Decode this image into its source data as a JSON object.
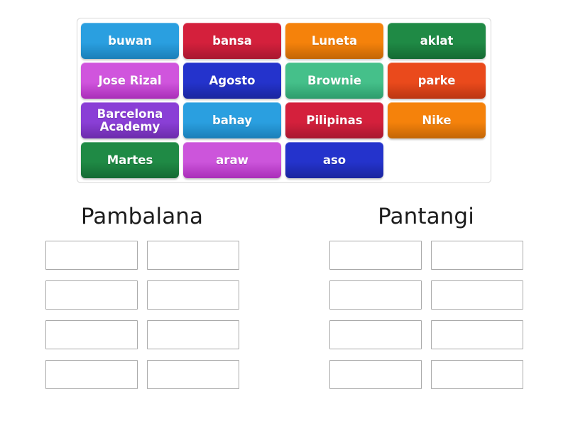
{
  "activity": {
    "type": "group-sort",
    "tile_pool": {
      "name": "word-tile-pool",
      "rows": [
        [
          {
            "label": "buwan",
            "color": "#2a9fe0",
            "shadow": "#1b7fb8"
          },
          {
            "label": "bansa",
            "color": "#d4203c",
            "shadow": "#a81830"
          },
          {
            "label": "Luneta",
            "color": "#f5820b",
            "shadow": "#c36606"
          },
          {
            "label": "aklat",
            "color": "#1f8a45",
            "shadow": "#156a33"
          }
        ],
        [
          {
            "label": "Jose Rizal",
            "color": "#d055dd",
            "shadow": "#a92eb8"
          },
          {
            "label": "Agosto",
            "color": "#2433cc",
            "shadow": "#1a259e"
          },
          {
            "label": "Brownie",
            "color": "#45c08a",
            "shadow": "#2e9c6c"
          },
          {
            "label": "parke",
            "color": "#ea4a1c",
            "shadow": "#bb3612"
          }
        ],
        [
          {
            "label": "Barcelona Academy",
            "color": "#8a3fd6",
            "shadow": "#6c2bab"
          },
          {
            "label": "bahay",
            "color": "#2a9fe0",
            "shadow": "#1b7fb8"
          },
          {
            "label": "Pilipinas",
            "color": "#d4203c",
            "shadow": "#a81830"
          },
          {
            "label": "Nike",
            "color": "#f5820b",
            "shadow": "#c36606"
          }
        ],
        [
          {
            "label": "Martes",
            "color": "#1f8a45",
            "shadow": "#156a33"
          },
          {
            "label": "araw",
            "color": "#cc55db",
            "shadow": "#a92eb8"
          },
          {
            "label": "aso",
            "color": "#2433cc",
            "shadow": "#1a259e"
          },
          {
            "label": "",
            "color": "",
            "shadow": "",
            "empty": true
          }
        ]
      ]
    },
    "groups": [
      {
        "name": "pambalana",
        "title": "Pambalana",
        "slots": [
          "",
          "",
          "",
          "",
          "",
          "",
          "",
          ""
        ]
      },
      {
        "name": "pantangi",
        "title": "Pantangi",
        "slots": [
          "",
          "",
          "",
          "",
          "",
          "",
          "",
          ""
        ]
      }
    ]
  }
}
